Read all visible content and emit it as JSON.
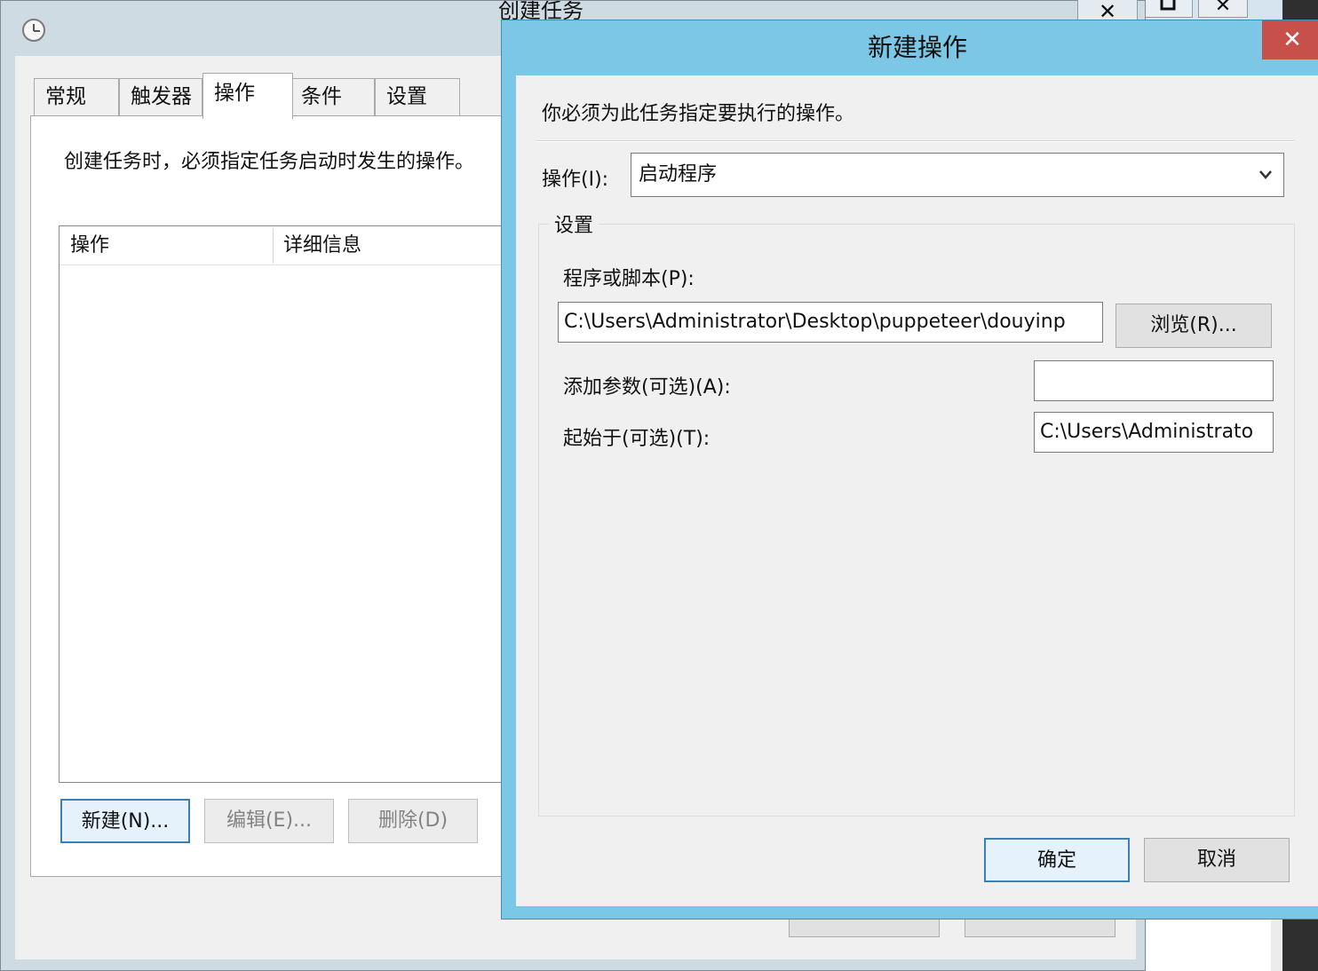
{
  "parent_dialog": {
    "title": "创建任务",
    "close_glyph": "✕",
    "tabs": [
      {
        "label": "常规",
        "active": false
      },
      {
        "label": "触发器",
        "active": false
      },
      {
        "label": "操作",
        "active": true
      },
      {
        "label": "条件",
        "active": false
      },
      {
        "label": "设置",
        "active": false
      }
    ],
    "description": "创建任务时，必须指定任务启动时发生的操作。",
    "list_columns": [
      "操作",
      "详细信息"
    ],
    "buttons": {
      "new": "新建(N)...",
      "edit": "编辑(E)...",
      "delete": "删除(D)"
    }
  },
  "background_window": {
    "close_glyph": "✕"
  },
  "new_action_dialog": {
    "title": "新建操作",
    "close_glyph": "✕",
    "instruction": "你必须为此任务指定要执行的操作。",
    "action_label": "操作(I):",
    "action_value": "启动程序",
    "settings_legend": "设置",
    "program_label": "程序或脚本(P):",
    "program_value": "C:\\Users\\Administrator\\Desktop\\puppeteer\\douyinp",
    "browse_button": "浏览(R)...",
    "args_label": "添加参数(可选)(A):",
    "args_value": "",
    "start_in_label": "起始于(可选)(T):",
    "start_in_value": "C:\\Users\\Administrato",
    "ok_button": "确定",
    "cancel_button": "取消"
  },
  "colors": {
    "child_frame": "#7cc7e6",
    "child_close": "#c7504a",
    "parent_frame": "#cfdbe3",
    "dialog_bg": "#f0f0f0",
    "default_button_border": "#3c7fb1"
  },
  "icons": {
    "parent_app": "task-scheduler-clock-icon",
    "dropdown": "chevron-down-icon"
  }
}
